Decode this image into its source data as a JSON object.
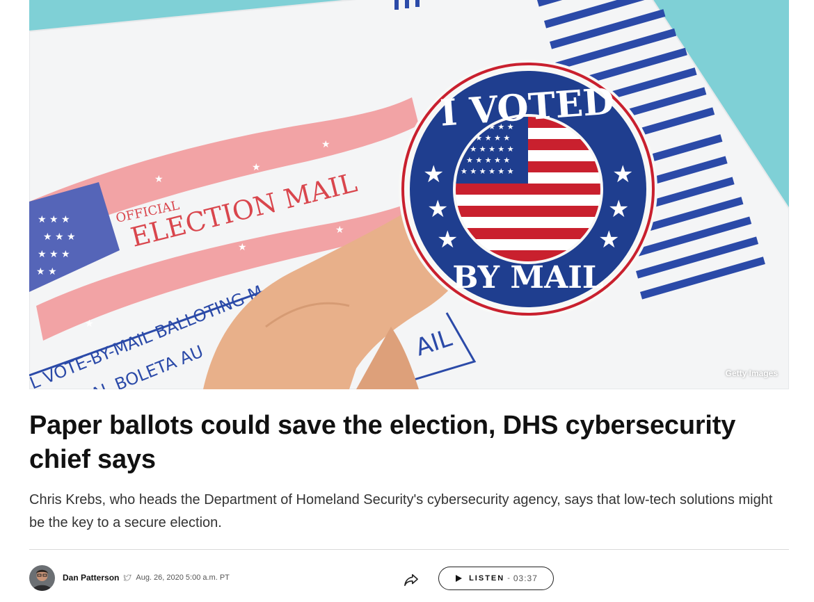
{
  "hero": {
    "credit": "Getty Images",
    "envelope_text": {
      "official": "OFFICIAL",
      "election_mail": "ELECTION MAIL",
      "line1": "L VOTE-BY-MAIL BALLOTING M",
      "line2": "FICIAL BOLETA AU",
      "mail": "AIL"
    },
    "sticker": {
      "top": "I VOTED",
      "bottom": "BY MAIL"
    },
    "colors": {
      "background": "#7fd0d6",
      "navy": "#1f3e8f",
      "red": "#c9202e",
      "pink": "#ef9a9c"
    }
  },
  "article": {
    "headline": "Paper ballots could save the election, DHS cybersecurity chief says",
    "dek": "Chris Krebs, who heads the Department of Homeland Security's cybersecurity agency, says that low-tech solutions might be the key to a secure election."
  },
  "byline": {
    "author": "Dan Patterson",
    "date": "Aug. 26, 2020 5:00 a.m. PT"
  },
  "audio": {
    "label": "LISTEN",
    "separator": "-",
    "duration": "03:37"
  }
}
